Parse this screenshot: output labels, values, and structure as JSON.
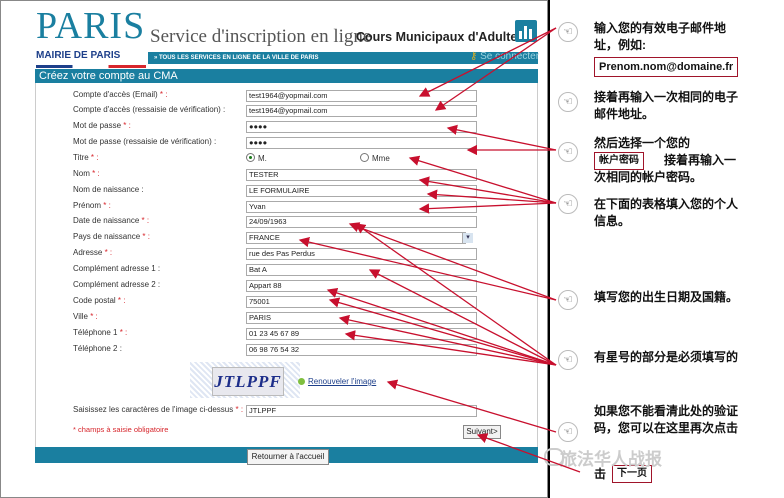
{
  "header": {
    "logo": "PARIS",
    "service": "Service d'inscription en ligne",
    "cma": "Cours Municipaux d'Adultes",
    "mairie": "MAIRIE DE PARIS",
    "topbar": "» TOUS LES SERVICES EN LIGNE DE LA VILLE DE PARIS",
    "connect": "Se connecter"
  },
  "form": {
    "title": "Créez votre compte au CMA",
    "fields": [
      {
        "label": "Compte d'accès (Email)",
        "req": " * :",
        "value": "test1964@yopmail.com"
      },
      {
        "label": "Compte d'accès (ressaisie de vérification) :",
        "req": "",
        "value": "test1964@yopmail.com"
      },
      {
        "label": "Mot de passe",
        "req": " * :",
        "value": "●●●●"
      },
      {
        "label": "Mot de passe (ressaisie de vérification) :",
        "req": "",
        "value": "●●●●"
      },
      {
        "label": "Titre",
        "req": " * :",
        "value": ""
      },
      {
        "label": "Nom",
        "req": " * :",
        "value": "TESTER"
      },
      {
        "label": "Nom de naissance :",
        "req": "",
        "value": "LE FORMULAIRE"
      },
      {
        "label": "Prénom",
        "req": " * :",
        "value": "Yvan"
      },
      {
        "label": "Date de naissance",
        "req": " * :",
        "value": "24/09/1963"
      },
      {
        "label": "Pays de naissance",
        "req": " * :",
        "value": "FRANCE"
      },
      {
        "label": "Adresse",
        "req": " * :",
        "value": "rue des Pas Perdus"
      },
      {
        "label": "Complément adresse 1 :",
        "req": "",
        "value": "Bat A"
      },
      {
        "label": "Complément adresse 2 :",
        "req": "",
        "value": "Appart 88"
      },
      {
        "label": "Code postal",
        "req": " * :",
        "value": "75001"
      },
      {
        "label": "Ville",
        "req": " * :",
        "value": "PARIS"
      },
      {
        "label": "Téléphone 1",
        "req": " * :",
        "value": "01 23 45 67 89"
      },
      {
        "label": "Téléphone 2 :",
        "req": "",
        "value": "06 98 76 54 32"
      }
    ],
    "title_m": "M.",
    "title_mme": "Mme",
    "select_arrow": "▾",
    "captcha_text": "JTLPPF",
    "refresh_label": "Renouveler l'image",
    "captcha_label": "Saisissez les caractères de l'image ci-dessus",
    "captcha_req": " * :",
    "captcha_value": "JTLPPF",
    "mandatory_note": "* champs à saisie obligatoire",
    "next_button": "Suivant>",
    "back_button": "Retourner à l'accueil"
  },
  "notes": {
    "n1": "输入您的有效电子邮件地址，例如:",
    "n1_box": "Prenom.nom@domaine.fr",
    "n2": "接着再输入一次相同的电子邮件地址。",
    "n3a": "然后选择一个您的",
    "n3_box": "帐户密码",
    "n3b": "接着再输入一次相同的帐户密码。",
    "n4": "在下面的表格填入您的个人信息。",
    "n5": "填写您的出生日期及国籍。",
    "n6": "有星号的部分是必须填写的",
    "n7": "如果您不能看清此处的验证码，您可以在这里再次点击",
    "n7_prefix": "击",
    "n7_box": "下一页",
    "hand_glyph": "☜",
    "watermark": "旅法华人战报"
  },
  "colors": {
    "brand": "#1a7fa0",
    "arrow": "#c8102e",
    "note_box": "#a0142a"
  }
}
